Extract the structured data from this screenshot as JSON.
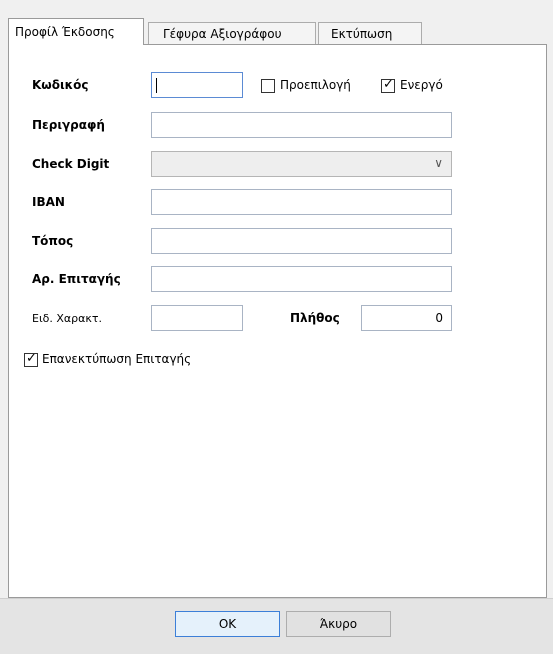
{
  "tabs": [
    {
      "label": "Προφίλ Έκδοσης",
      "active": true
    },
    {
      "label": "Γέφυρα Αξιογράφου",
      "active": false
    },
    {
      "label": "Εκτύπωση",
      "active": false
    }
  ],
  "form": {
    "code_label": "Κωδικός",
    "code_value": "",
    "default_label": "Προεπιλογή",
    "default_checked": false,
    "active_label": "Ενεργό",
    "active_checked": true,
    "description_label": "Περιγραφή",
    "description_value": "",
    "check_digit_label": "Check Digit",
    "check_digit_value": "",
    "iban_label": "IBAN",
    "iban_value": "",
    "place_label": "Τόπος",
    "place_value": "",
    "cheque_no_label": "Αρ. Επιταγής",
    "cheque_no_value": "",
    "special_char_label": "Ειδ. Χαρακτ.",
    "special_char_value": "",
    "quantity_label": "Πλήθος",
    "quantity_value": "0",
    "reprint_label": "Επανεκτύπωση Επιταγής",
    "reprint_checked": true
  },
  "buttons": {
    "ok_label": "OK",
    "cancel_label": "Άκυρο"
  },
  "colors": {
    "field_border": "#a9b4c4",
    "focus_border": "#5b8bd4",
    "default_button_border": "#3c7fd8"
  }
}
